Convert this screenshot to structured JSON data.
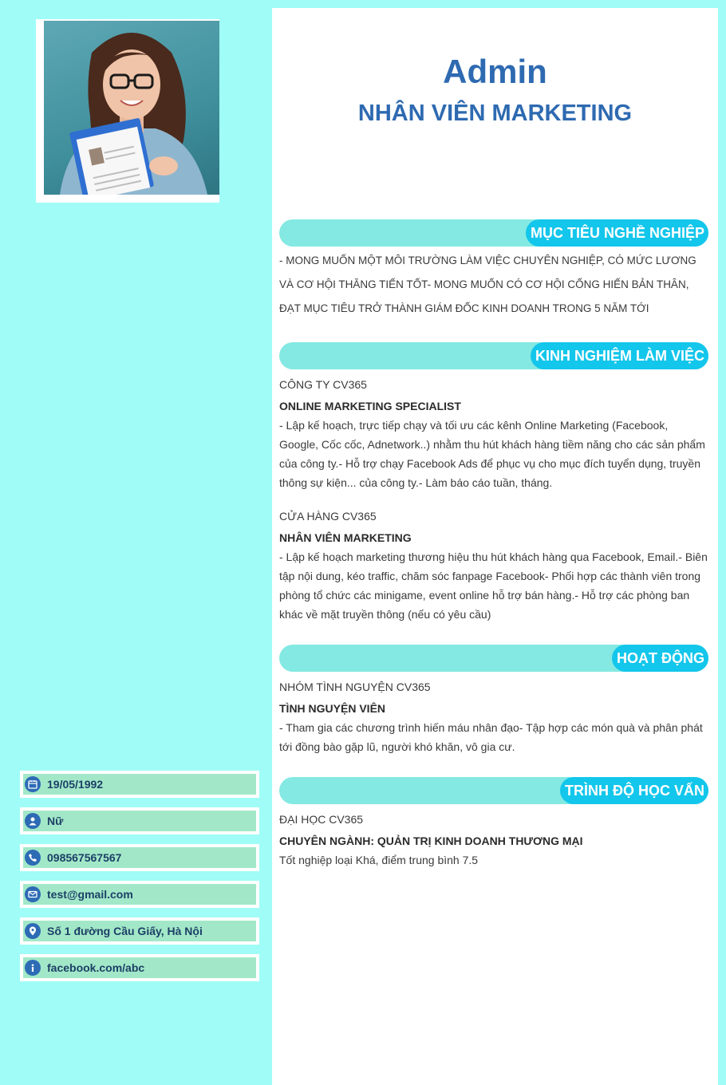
{
  "profile": {
    "name": "Admin",
    "job_title": "NHÂN VIÊN MARKETING"
  },
  "contacts": [
    {
      "icon": "calendar-icon",
      "text": "19/05/1992"
    },
    {
      "icon": "user-icon",
      "text": "Nữ"
    },
    {
      "icon": "phone-icon",
      "text": "098567567567"
    },
    {
      "icon": "email-icon",
      "text": "test@gmail.com"
    },
    {
      "icon": "location-icon",
      "text": "Số 1 đường Cầu Giấy, Hà Nội"
    },
    {
      "icon": "info-icon",
      "text": "facebook.com/abc"
    }
  ],
  "sections": {
    "objective": {
      "heading": "MỤC TIÊU NGHỀ NGHIỆP",
      "text": "- MONG MUỐN MỘT MÔI TRƯỜNG LÀM VIỆC CHUYÊN NGHIỆP, CÓ MỨC LƯƠNG VÀ CƠ HỘI THĂNG TIẾN TỐT- MONG MUỐN CÓ CƠ HỘI CỐNG HIẾN BẢN THÂN, ĐẠT MỤC TIÊU TRỞ THÀNH GIÁM ĐỐC KINH DOANH TRONG 5 NĂM TỚI"
    },
    "experience": {
      "heading": "KINH NGHIỆM LÀM VIỆC",
      "items": [
        {
          "org": "CÔNG TY CV365",
          "role": "ONLINE MARKETING SPECIALIST",
          "desc": "- Lập kế hoạch, trực tiếp chạy và tối ưu các kênh Online Marketing (Facebook, Google, Cốc cốc, Adnetwork..) nhằm thu hút khách hàng tiềm năng cho các sản phẩm của công ty.- Hỗ trợ chạy Facebook Ads để phục vụ cho mục đích tuyển dụng, truyền thông sự kiện... của công ty.- Làm báo cáo tuần, tháng."
        },
        {
          "org": "CỬA HÀNG CV365",
          "role": "NHÂN VIÊN MARKETING",
          "desc": "- Lập kế hoạch marketing thương hiệu thu hút khách hàng qua Facebook, Email.- Biên tập nội dung, kéo traffic, chăm sóc fanpage Facebook- Phối hợp các thành viên trong phòng tổ chức các minigame, event online hỗ trợ bán hàng.- Hỗ trợ các phòng ban khác về mặt truyền thông (nếu có yêu cầu)"
        }
      ]
    },
    "activities": {
      "heading": "HOẠT ĐỘNG",
      "org": "NHÓM TÌNH NGUYỆN CV365",
      "role": "TÌNH NGUYỆN VIÊN",
      "desc": "- Tham gia các chương trình hiến máu nhân đạo- Tập hợp các món quà và phân phát tới đồng bào gặp lũ, người khó khăn, vô gia cư."
    },
    "education": {
      "heading": "TRÌNH ĐỘ HỌC VẤN",
      "org": "ĐẠI HỌC CV365",
      "role": "CHUYÊN NGÀNH: QUẢN TRỊ KINH DOANH THƯƠNG MẠI",
      "desc": "Tốt nghiệp loại Khá, điểm trung bình 7.5"
    }
  },
  "colors": {
    "page_bg": "#a0fcf6",
    "accent_blue": "#2e6ab1",
    "section_bar": "#83e9e2",
    "section_label": "#13c6eb",
    "contact_bg": "#a2e8c8"
  }
}
